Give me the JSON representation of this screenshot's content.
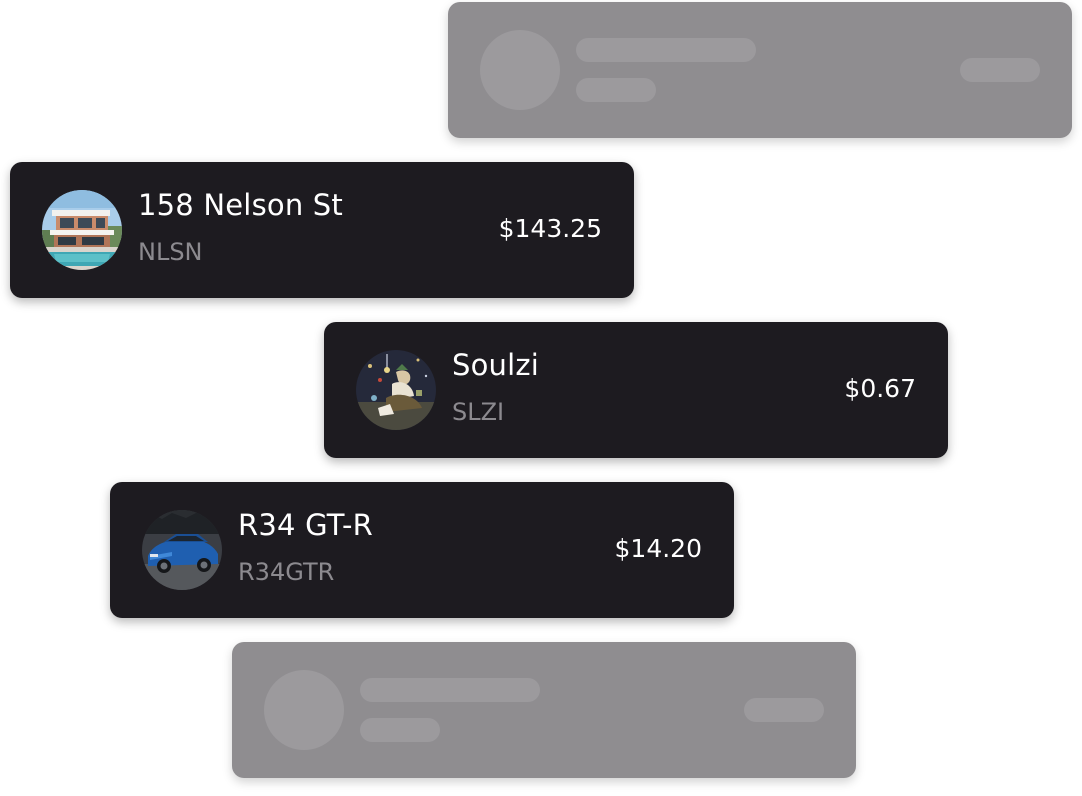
{
  "assets": [
    {
      "name": "158 Nelson St",
      "ticker": "NLSN",
      "price": "$143.25",
      "image": "modern-house-photo"
    },
    {
      "name": "Soulzi",
      "ticker": "SLZI",
      "price": "$0.67",
      "image": "illustrated-character-art"
    },
    {
      "name": "R34 GT-R",
      "ticker": "R34GTR",
      "price": "$14.20",
      "image": "blue-sports-car-photo"
    }
  ],
  "colors": {
    "card_background": "#1d1b20",
    "placeholder_card": "#8f8d90",
    "placeholder_shape": "#9c9a9d",
    "ticker_text": "#8c8a8f",
    "primary_text": "#ffffff"
  }
}
